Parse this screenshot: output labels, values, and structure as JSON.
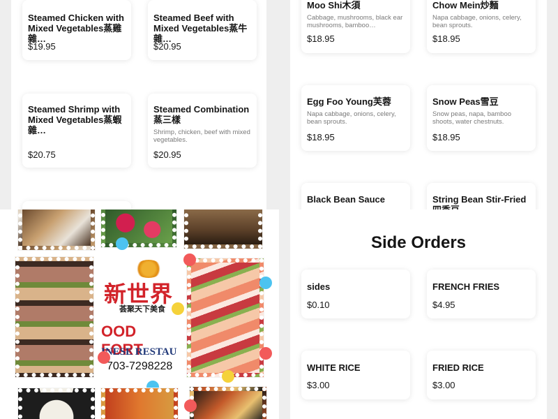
{
  "top_left": {
    "cards": [
      {
        "name": "Steamed Chicken with Mixed Vegetables蒸雞雜…",
        "desc": "",
        "price": "$19.95"
      },
      {
        "name": "Steamed Beef with Mixed Vegetables蒸牛雜…",
        "desc": "",
        "price": "$20.95"
      },
      {
        "name": "Steamed Shrimp with Mixed Vegetables蒸蝦雜…",
        "desc": "",
        "price": "$20.75"
      },
      {
        "name": "Steamed Combination蒸三樣",
        "desc": "Shrimp, chicken, beef with mixed vegetables.",
        "price": "$20.95"
      }
    ]
  },
  "top_right": {
    "cards": [
      {
        "name": "Moo Shi木須",
        "desc": "Cabbage, mushrooms, black ear mushrooms, bamboo…",
        "price": "$18.95"
      },
      {
        "name": "Chow Mein炒麵",
        "desc": "Napa cabbage, onions, celery, bean sprouts.",
        "price": "$18.95"
      },
      {
        "name": "Egg Foo Young芙蓉",
        "desc": "Napa cabbage, onions, celery, bean sprouts.",
        "price": "$18.95"
      },
      {
        "name": "Snow Peas雪豆",
        "desc": "Snow peas, napa, bamboo shoots, water chestnuts.",
        "price": "$18.95"
      },
      {
        "name": "Black Bean Sauce",
        "desc": "",
        "price": ""
      },
      {
        "name": "String Bean Stir-Fried四季豆",
        "desc": "",
        "price": ""
      }
    ]
  },
  "bottom_left": {
    "logo_chinese": "新世界",
    "logo_sub": "荟聚天下美食",
    "logo_en": "OOD FORT",
    "logo_en2": "INESE RESTAU",
    "phone": "703-7298228"
  },
  "bottom_right": {
    "title": "Side Orders",
    "cards": [
      {
        "name": "sides",
        "price": "$0.10"
      },
      {
        "name": "FRENCH FRIES",
        "price": "$4.95"
      },
      {
        "name": "WHITE RICE",
        "price": "$3.00"
      },
      {
        "name": "FRIED RICE",
        "price": "$3.00"
      }
    ]
  }
}
